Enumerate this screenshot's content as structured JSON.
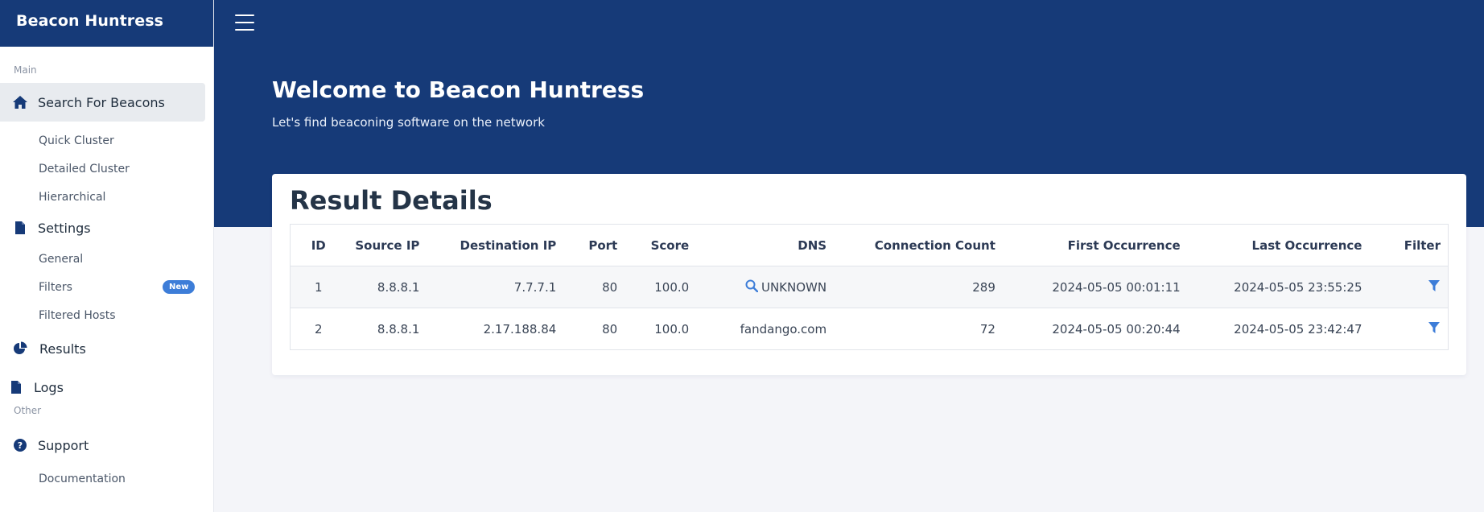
{
  "app": {
    "title": "Beacon Huntress"
  },
  "sidebar": {
    "sections": [
      {
        "label": "Main"
      },
      {
        "label": "Other"
      }
    ],
    "items": [
      {
        "label": "Search For Beacons",
        "icon": "home-icon",
        "active": true
      },
      {
        "label": "Quick Cluster"
      },
      {
        "label": "Detailed Cluster"
      },
      {
        "label": "Hierarchical"
      },
      {
        "label": "Settings",
        "icon": "document-icon"
      },
      {
        "label": "General"
      },
      {
        "label": "Filters",
        "badge": "New"
      },
      {
        "label": "Filtered Hosts"
      },
      {
        "label": "Results",
        "icon": "pie-chart-icon"
      },
      {
        "label": "Logs",
        "icon": "document-icon"
      },
      {
        "label": "Support",
        "icon": "question-circle-icon"
      },
      {
        "label": "Documentation"
      }
    ]
  },
  "header": {
    "menu_icon": "hamburger-icon",
    "title": "Welcome to Beacon Huntress",
    "subtitle": "Let's find beaconing software on the network"
  },
  "results": {
    "title": "Result Details",
    "columns": [
      "ID",
      "Source IP",
      "Destination IP",
      "Port",
      "Score",
      "DNS",
      "Connection Count",
      "First Occurrence",
      "Last Occurrence",
      "Filter"
    ],
    "rows": [
      {
        "id": "1",
        "source_ip": "8.8.8.1",
        "destination_ip": "7.7.7.1",
        "port": "80",
        "score": "100.0",
        "dns": "UNKNOWN",
        "dns_icon": "search-icon",
        "connection_count": "289",
        "first_occurrence": "2024-05-05 00:01:11",
        "last_occurrence": "2024-05-05 23:55:25",
        "filter_icon": "filter-icon"
      },
      {
        "id": "2",
        "source_ip": "8.8.8.1",
        "destination_ip": "2.17.188.84",
        "port": "80",
        "score": "100.0",
        "dns": "fandango.com",
        "connection_count": "72",
        "first_occurrence": "2024-05-05 00:20:44",
        "last_occurrence": "2024-05-05 23:42:47",
        "filter_icon": "filter-icon"
      }
    ]
  },
  "colors": {
    "brand": "#163a78",
    "accent": "#3d7dd8",
    "background": "#f4f5f9"
  }
}
